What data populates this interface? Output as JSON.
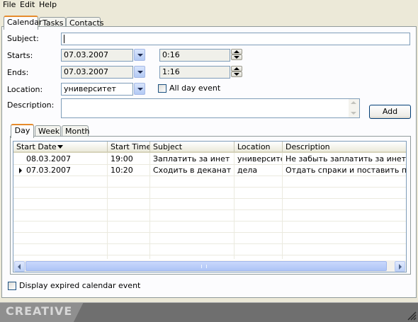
{
  "menu": [
    "File",
    "Edit",
    "Help"
  ],
  "tabs": [
    "Calendar",
    "Tasks",
    "Contacts"
  ],
  "form": {
    "subject_label": "Subject:",
    "subject_value": "",
    "starts_label": "Starts:",
    "starts_date": "07.03.2007",
    "starts_time": "0:16",
    "ends_label": "Ends:",
    "ends_date": "07.03.2007",
    "ends_time": "1:16",
    "location_label": "Location:",
    "location_value": "университет",
    "all_day_label": "All day event",
    "description_label": "Description:",
    "description_value": "",
    "add_button": "Add"
  },
  "view_tabs": [
    "Day",
    "Week",
    "Month"
  ],
  "grid": {
    "columns": [
      "Start Date",
      "Start Time",
      "Subject",
      "Location",
      "Description"
    ],
    "rows": [
      {
        "start_date": "08.03.2007",
        "start_time": "19:00",
        "subject": "Заплатить за инет",
        "location": "университет",
        "description": "Не забыть заплатить за инет"
      },
      {
        "start_date": "07.03.2007",
        "start_time": "10:20",
        "subject": "Сходить в деканат",
        "location": "дела",
        "description": "Отдать спраки и поставить печати"
      }
    ]
  },
  "expired_label": "Display expired calendar event",
  "brand": "CREATIVE",
  "colors": {
    "tab_accent": "#e68b2c",
    "footer": "#787878",
    "scroll_blue": "#b2c9f4"
  }
}
